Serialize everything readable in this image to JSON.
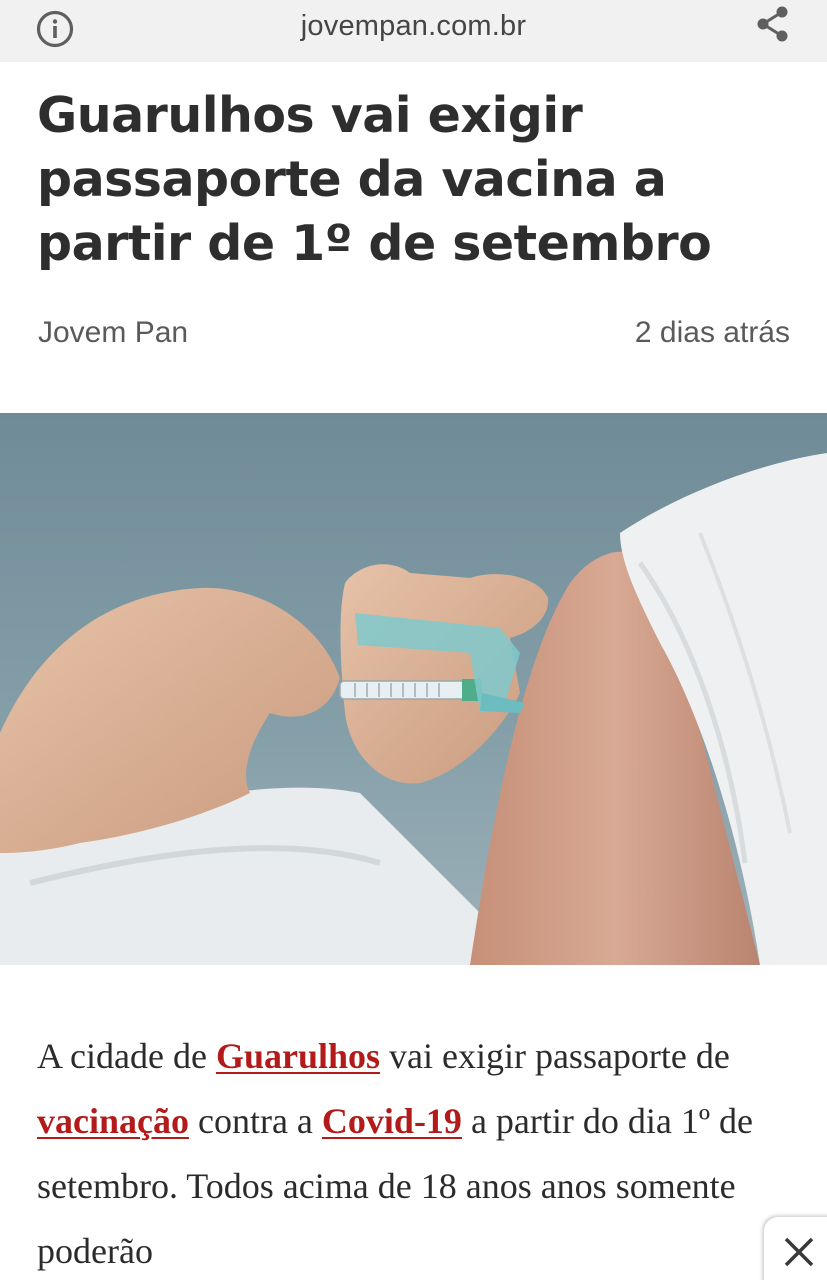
{
  "topbar": {
    "domain": "jovempan.com.br",
    "info_icon": "info-circle-icon",
    "share_icon": "share-icon"
  },
  "article": {
    "headline": "Guarulhos vai exigir passaporte da vacina a partir de 1º de setembro",
    "source": "Jovem Pan",
    "time": "2 dias atrás",
    "image_alt": "vaccine-injection-photo",
    "body": {
      "p1": "A cidade de ",
      "link1": "Guarulhos",
      "p2": " vai exigir passaporte de ",
      "link2": "vacinação",
      "p3": " contra a ",
      "link3": "Covid-19",
      "p4": " a partir do dia 1º de setembro. Todos acima de 18 anos anos somente poderão"
    }
  },
  "overlay": {
    "close_icon": "close-icon"
  }
}
